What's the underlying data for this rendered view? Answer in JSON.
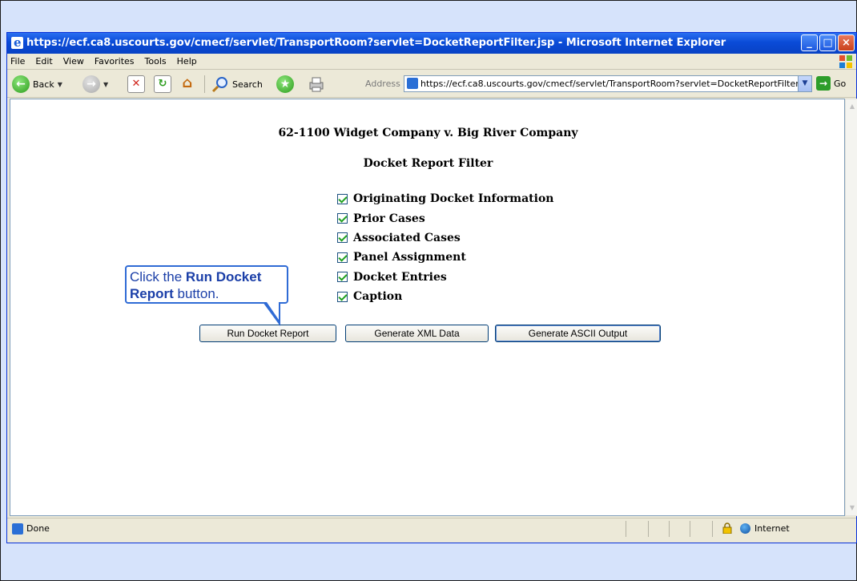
{
  "window": {
    "title": "https://ecf.ca8.uscourts.gov/cmecf/servlet/TransportRoom?servlet=DocketReportFilter.jsp - Microsoft Internet Explorer"
  },
  "menu": [
    "File",
    "Edit",
    "View",
    "Favorites",
    "Tools",
    "Help"
  ],
  "toolbar": {
    "back_label": "Back",
    "search_label": "Search",
    "address_label": "Address",
    "address_value": "https://ecf.ca8.uscourts.gov/cmecf/servlet/TransportRoom?servlet=DocketReportFilter.jsp",
    "go_label": "Go"
  },
  "page": {
    "case_title": "62-1100 Widget Company v. Big River Company",
    "form_title": "Docket Report Filter",
    "options": [
      {
        "label": "Originating Docket Information",
        "checked": true
      },
      {
        "label": "Prior Cases",
        "checked": true
      },
      {
        "label": "Associated Cases",
        "checked": true
      },
      {
        "label": "Panel Assignment",
        "checked": true
      },
      {
        "label": "Docket Entries",
        "checked": true
      },
      {
        "label": "Caption",
        "checked": true
      }
    ],
    "buttons": {
      "run": "Run Docket Report",
      "xml": "Generate XML Data",
      "ascii": "Generate ASCII Output"
    }
  },
  "callout": {
    "prefix": "Click the ",
    "emphasis": "Run Docket Report",
    "suffix": " button."
  },
  "status": {
    "text": "Done",
    "zone": "Internet"
  },
  "colors": {
    "title_bar": "#0a4bd8",
    "callout_text": "#1b3fa8",
    "slide_background": "#d6e3fb"
  }
}
